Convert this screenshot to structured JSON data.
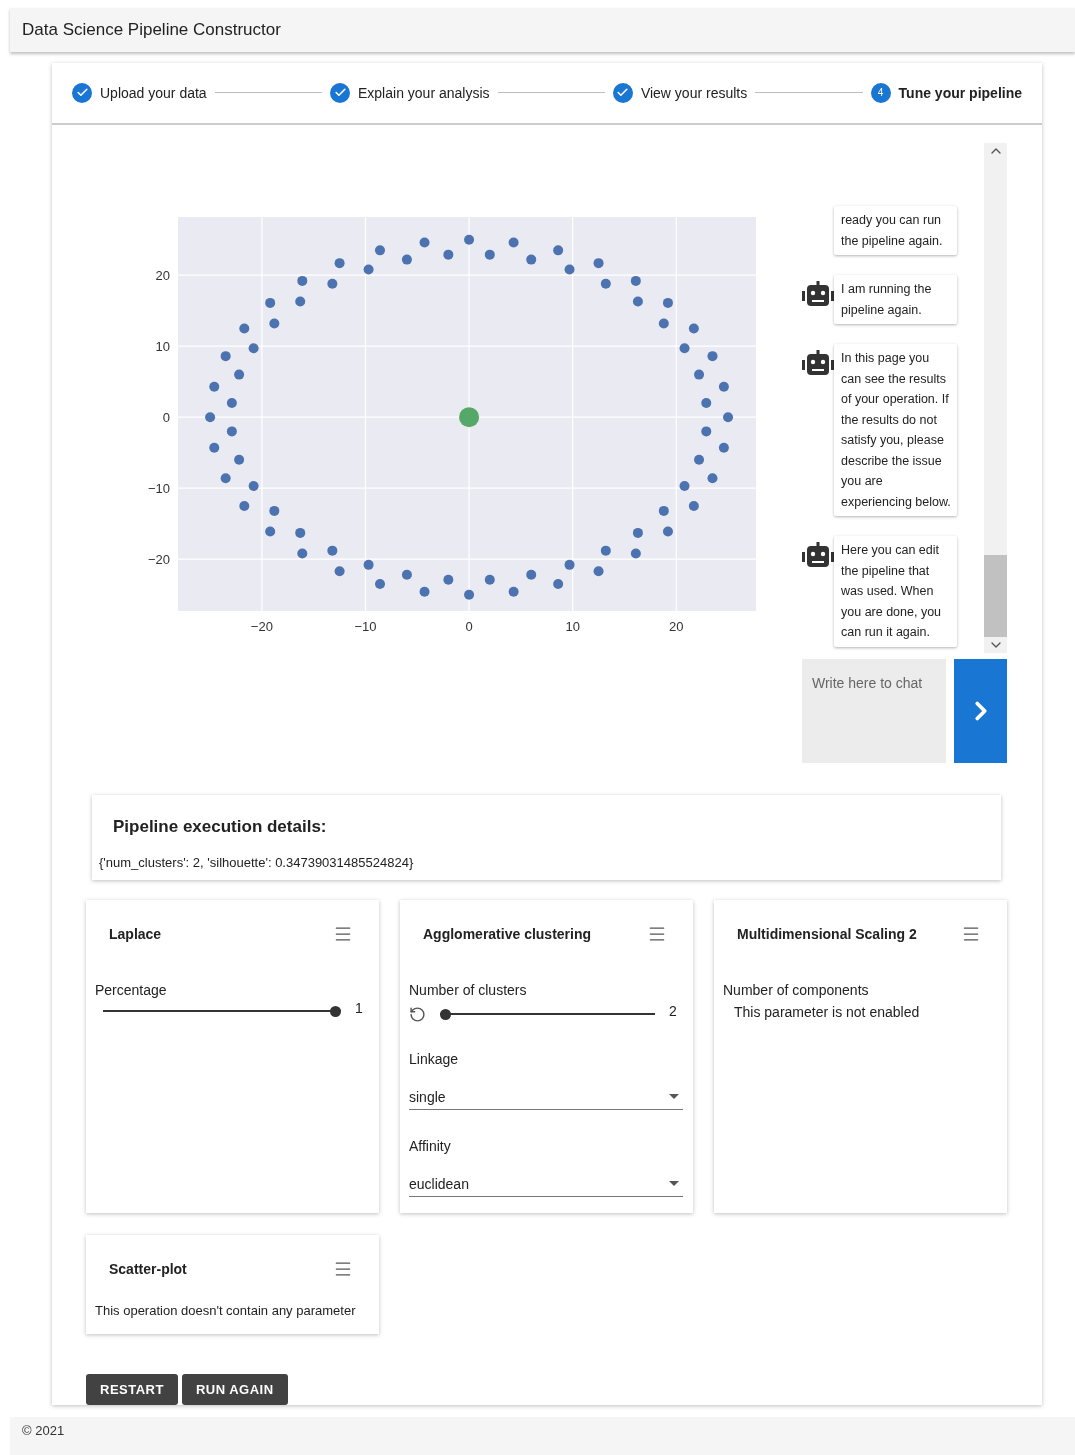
{
  "app_bar": {
    "title": "Data Science Pipeline Constructor"
  },
  "stepper": [
    {
      "label": "Upload your data",
      "completed": true,
      "selected": false
    },
    {
      "label": "Explain your analysis",
      "completed": true,
      "selected": false
    },
    {
      "label": "View your results",
      "completed": true,
      "selected": false
    },
    {
      "label": "Tune your pipeline",
      "number": "4",
      "completed": false,
      "selected": true
    }
  ],
  "chart": {
    "chart_data": {
      "type": "scatter",
      "grid": true,
      "xlim": [
        -28.1,
        27.7
      ],
      "ylim": [
        -27.3,
        28.2
      ],
      "xticks": [
        -20,
        -10,
        0,
        10,
        20
      ],
      "yticks": [
        -20,
        -10,
        0,
        10,
        20
      ],
      "series": [
        {
          "color": "#4c72b0",
          "x": [
            25,
            24.6,
            23.5,
            21.7,
            19.2,
            16.1,
            12.5,
            8.6,
            4.3,
            0,
            -4.3,
            -8.6,
            -12.5,
            -16.1,
            -19.2,
            -21.7,
            -23.5,
            -24.6,
            -25,
            -24.6,
            -23.5,
            -21.7,
            -19.2,
            -16.1,
            -12.5,
            -8.6,
            -4.3,
            0,
            4.3,
            8.6,
            12.5,
            16.1,
            19.2,
            21.7,
            23.5,
            24.6,
            22.9,
            22.2,
            20.8,
            18.8,
            16.3,
            13.2,
            9.7,
            6.0,
            2.0,
            -2.0,
            -6.0,
            -9.7,
            -13.2,
            -16.3,
            -18.8,
            -20.8,
            -22.2,
            -22.9,
            -22.9,
            -22.2,
            -20.8,
            -18.8,
            -16.3,
            -13.2,
            -9.7,
            -6.0,
            -2.0,
            2.0,
            6.0,
            9.7,
            13.2,
            16.3,
            18.8,
            20.8,
            22.2,
            22.9
          ],
          "values": [
            0,
            4.3,
            8.6,
            12.5,
            16.1,
            19.2,
            21.7,
            23.5,
            24.6,
            25,
            24.6,
            23.5,
            21.7,
            19.2,
            16.1,
            12.5,
            8.6,
            4.3,
            0,
            -4.3,
            -8.6,
            -12.5,
            -16.1,
            -19.2,
            -21.7,
            -23.5,
            -24.6,
            -25,
            -24.6,
            -23.5,
            -21.7,
            -19.2,
            -16.1,
            -12.5,
            -8.6,
            -4.3,
            2.0,
            6.0,
            9.7,
            13.2,
            16.3,
            18.8,
            20.8,
            22.2,
            22.9,
            22.9,
            22.2,
            20.8,
            18.8,
            16.3,
            13.2,
            9.7,
            6.0,
            2.0,
            -2.0,
            -6.0,
            -9.7,
            -13.2,
            -16.3,
            -18.8,
            -20.8,
            -22.2,
            -22.9,
            -22.9,
            -22.2,
            -20.8,
            -18.8,
            -16.3,
            -13.2,
            -9.7,
            -6.0,
            -2.0
          ]
        },
        {
          "color": "#55a868",
          "x": [
            0
          ],
          "values": [
            0
          ]
        }
      ]
    }
  },
  "chat": {
    "messages": [
      {
        "text": "ready you can run the pipeline again.",
        "avatar": false
      },
      {
        "text": "I am running the pipeline again.",
        "avatar": true
      },
      {
        "text": "In this page you can see the results of your operation. If the results do not satisfy you, please describe the issue you are experiencing below.",
        "avatar": true
      },
      {
        "text": "Here you can edit the pipeline that was used. When you are done, you can run it again.",
        "avatar": true
      }
    ],
    "input": {
      "placeholder": "Write here to chat"
    }
  },
  "execution_details": {
    "title": "Pipeline execution details:",
    "text": "{'num_clusters': 2, 'silhouette': 0.34739031485524824}"
  },
  "operations": [
    {
      "title": "Laplace",
      "params": [
        {
          "kind": "slider",
          "label": "Percentage",
          "value": "1",
          "level": 1,
          "reset": false
        }
      ]
    },
    {
      "title": "Agglomerative clustering",
      "params": [
        {
          "kind": "slider",
          "label": "Number of clusters",
          "value": "2",
          "level": 0,
          "reset": true
        },
        {
          "kind": "select",
          "label": "Linkage",
          "value": "single"
        },
        {
          "kind": "select",
          "label": "Affinity",
          "value": "euclidean"
        }
      ]
    },
    {
      "title": "Multidimensional Scaling 2",
      "params": [
        {
          "kind": "disabled",
          "label": "Number of components",
          "note": "This parameter is not enabled"
        }
      ]
    },
    {
      "title": "Scatter-plot",
      "empty_text": "This operation doesn't contain any parameter"
    }
  ],
  "buttons": [
    "RESTART",
    "RUN AGAIN"
  ],
  "footer": "© 2021"
}
